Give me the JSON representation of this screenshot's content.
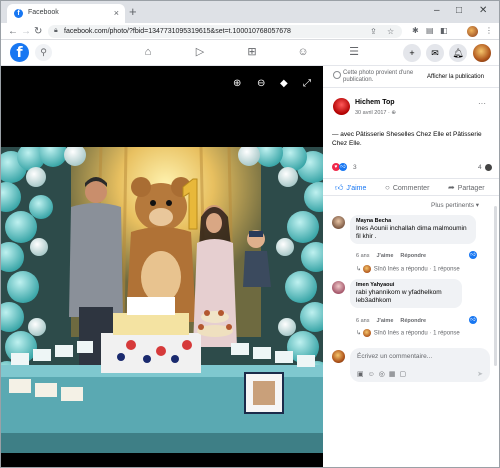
{
  "browser": {
    "tab_title": "Facebook",
    "tab_close": "×",
    "new_tab": "+",
    "url": "facebook.com/photo/?fbid=1347731095319615&set=t.100010768057678",
    "window_controls": [
      "–",
      "□",
      "✕"
    ]
  },
  "fb_header": {
    "logo": "f"
  },
  "sponsor": {
    "text": "Cette photo provient d'une publication.",
    "button": "Afficher la publication"
  },
  "post": {
    "author": "Hichem Top",
    "date": "30 avril 2017 · ",
    "caption": "— avec Pâtisserie Sheselles Chez Elle et Pâtisserie Chez Elle.",
    "reactions_count": "3",
    "comments_count": "4",
    "actions": {
      "like": "J'aime",
      "comment": "Commenter",
      "share": "Partager"
    },
    "sort_label": "Plus pertinents ▾"
  },
  "comments": [
    {
      "author": "Mayna Becha",
      "text": "Ines Aounii inchallah dima malmoumin fil khir .",
      "age": "6 ans",
      "like": "J'aime",
      "reply": "Répondre",
      "replies": "Sînô Inès a répondu · 1 réponse"
    },
    {
      "author": "Imen Yahyaoui",
      "text": "rabi yhannikom w yfadhelkom leb3adhkom",
      "age": "6 ans",
      "like": "J'aime",
      "reply": "Répondre",
      "replies": "Sînô Inès a répondu · 1 réponse"
    }
  ],
  "composer": {
    "placeholder": "Écrivez un commentaire..."
  },
  "colors": {
    "brand": "#1877f2",
    "viewer_bg": "#000000",
    "panel_bg": "#ffffff"
  }
}
